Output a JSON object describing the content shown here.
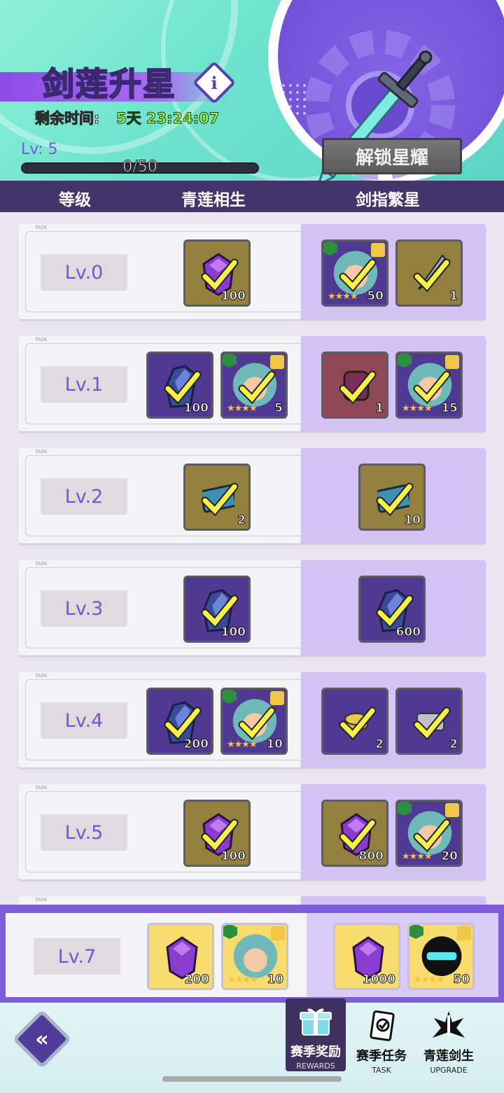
{
  "header": {
    "title": "剑莲升星",
    "remaining_label": "剩余时间:",
    "remaining_value": "5天 23:24:07",
    "level_label": "Lv: 5",
    "progress_text": "0/50",
    "progress_fraction": 0,
    "unlock_button": "解锁星耀"
  },
  "columns": {
    "level": "等级",
    "free": "青莲相生",
    "premium": "剑指繁星"
  },
  "task_tag": "TASK",
  "rows": [
    {
      "level": "Lv.0",
      "free": [
        {
          "icon": "purple-gem-icon",
          "count": "100"
        }
      ],
      "premium": [
        {
          "icon": "hero-portrait-icon",
          "count": "50"
        },
        {
          "icon": "sword-icon",
          "count": "1"
        }
      ]
    },
    {
      "level": "Lv.1",
      "free": [
        {
          "icon": "blue-gem-icon",
          "count": "100"
        },
        {
          "icon": "hero-portrait-icon",
          "count": "5"
        }
      ],
      "premium": [
        {
          "icon": "armor-icon",
          "count": "1"
        },
        {
          "icon": "hero-portrait-icon",
          "count": "15"
        }
      ]
    },
    {
      "level": "Lv.2",
      "free": [
        {
          "icon": "ticket-icon",
          "count": "2"
        }
      ],
      "premium": [
        {
          "icon": "ticket-icon",
          "count": "10"
        }
      ]
    },
    {
      "level": "Lv.3",
      "free": [
        {
          "icon": "blue-gem-icon",
          "count": "100"
        }
      ],
      "premium": [
        {
          "icon": "blue-gem-icon",
          "count": "600"
        }
      ]
    },
    {
      "level": "Lv.4",
      "free": [
        {
          "icon": "blue-gem-icon",
          "count": "200"
        },
        {
          "icon": "hero-portrait-icon",
          "count": "10"
        }
      ],
      "premium": [
        {
          "icon": "gold-coin-2h-icon",
          "count": "2"
        },
        {
          "icon": "silver-bar-2h-icon",
          "count": "2"
        }
      ]
    },
    {
      "level": "Lv.5",
      "free": [
        {
          "icon": "purple-gem-icon",
          "count": "100"
        }
      ],
      "premium": [
        {
          "icon": "purple-gem-icon",
          "count": "800"
        },
        {
          "icon": "hero-portrait-icon",
          "count": "20"
        }
      ]
    }
  ],
  "featured": {
    "level": "Lv.7",
    "free": [
      {
        "icon": "purple-gem-icon",
        "count": "200"
      },
      {
        "icon": "hero-portrait-icon",
        "count": "10"
      }
    ],
    "premium": [
      {
        "icon": "purple-gem-icon",
        "count": "1000"
      },
      {
        "icon": "shadow-hero-icon",
        "count": "50"
      }
    ]
  },
  "footer": {
    "back_icon": "double-chevron-left-icon",
    "tabs": [
      {
        "label": "赛季奖励",
        "sub": "REWARDS",
        "icon": "gift-icon",
        "active": true
      },
      {
        "label": "赛季任务",
        "sub": "TASK",
        "icon": "scroll-icon",
        "active": false
      },
      {
        "label": "青莲剑生",
        "sub": "UPGRADE",
        "icon": "lotus-icon",
        "active": false
      }
    ]
  },
  "colors": {
    "accent_purple": "#7f52e0",
    "timer_green": "#9dfd3a",
    "column_header": "#43346b",
    "premium_bg": "#d3c3f5"
  }
}
